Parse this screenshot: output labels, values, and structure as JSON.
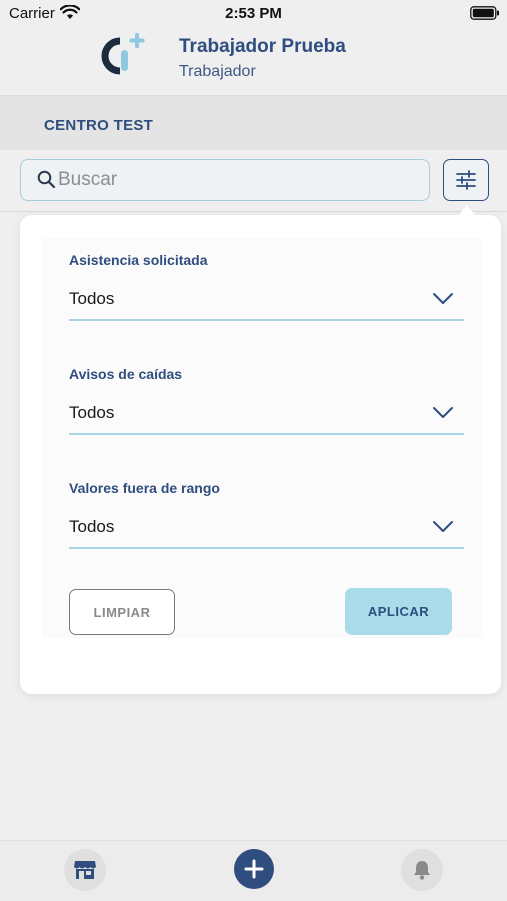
{
  "status_bar": {
    "carrier": "Carrier",
    "time": "2:53 PM"
  },
  "header": {
    "user_name": "Trabajador Prueba",
    "user_role": "Trabajador"
  },
  "center": {
    "label": "CENTRO TEST"
  },
  "search": {
    "placeholder": "Buscar",
    "value": ""
  },
  "filters": {
    "fields": [
      {
        "label": "Asistencia solicitada",
        "value": "Todos"
      },
      {
        "label": "Avisos de caídas",
        "value": "Todos"
      },
      {
        "label": "Valores fuera de rango",
        "value": "Todos"
      }
    ],
    "clear_label": "LIMPIAR",
    "apply_label": "APLICAR"
  },
  "tab_bar": {
    "icons": [
      "store-icon",
      "add-icon",
      "bell-icon"
    ]
  },
  "colors": {
    "primary": "#2f4d7e",
    "accent": "#a9dbeb",
    "logo_accent": "#8ec9e0"
  }
}
